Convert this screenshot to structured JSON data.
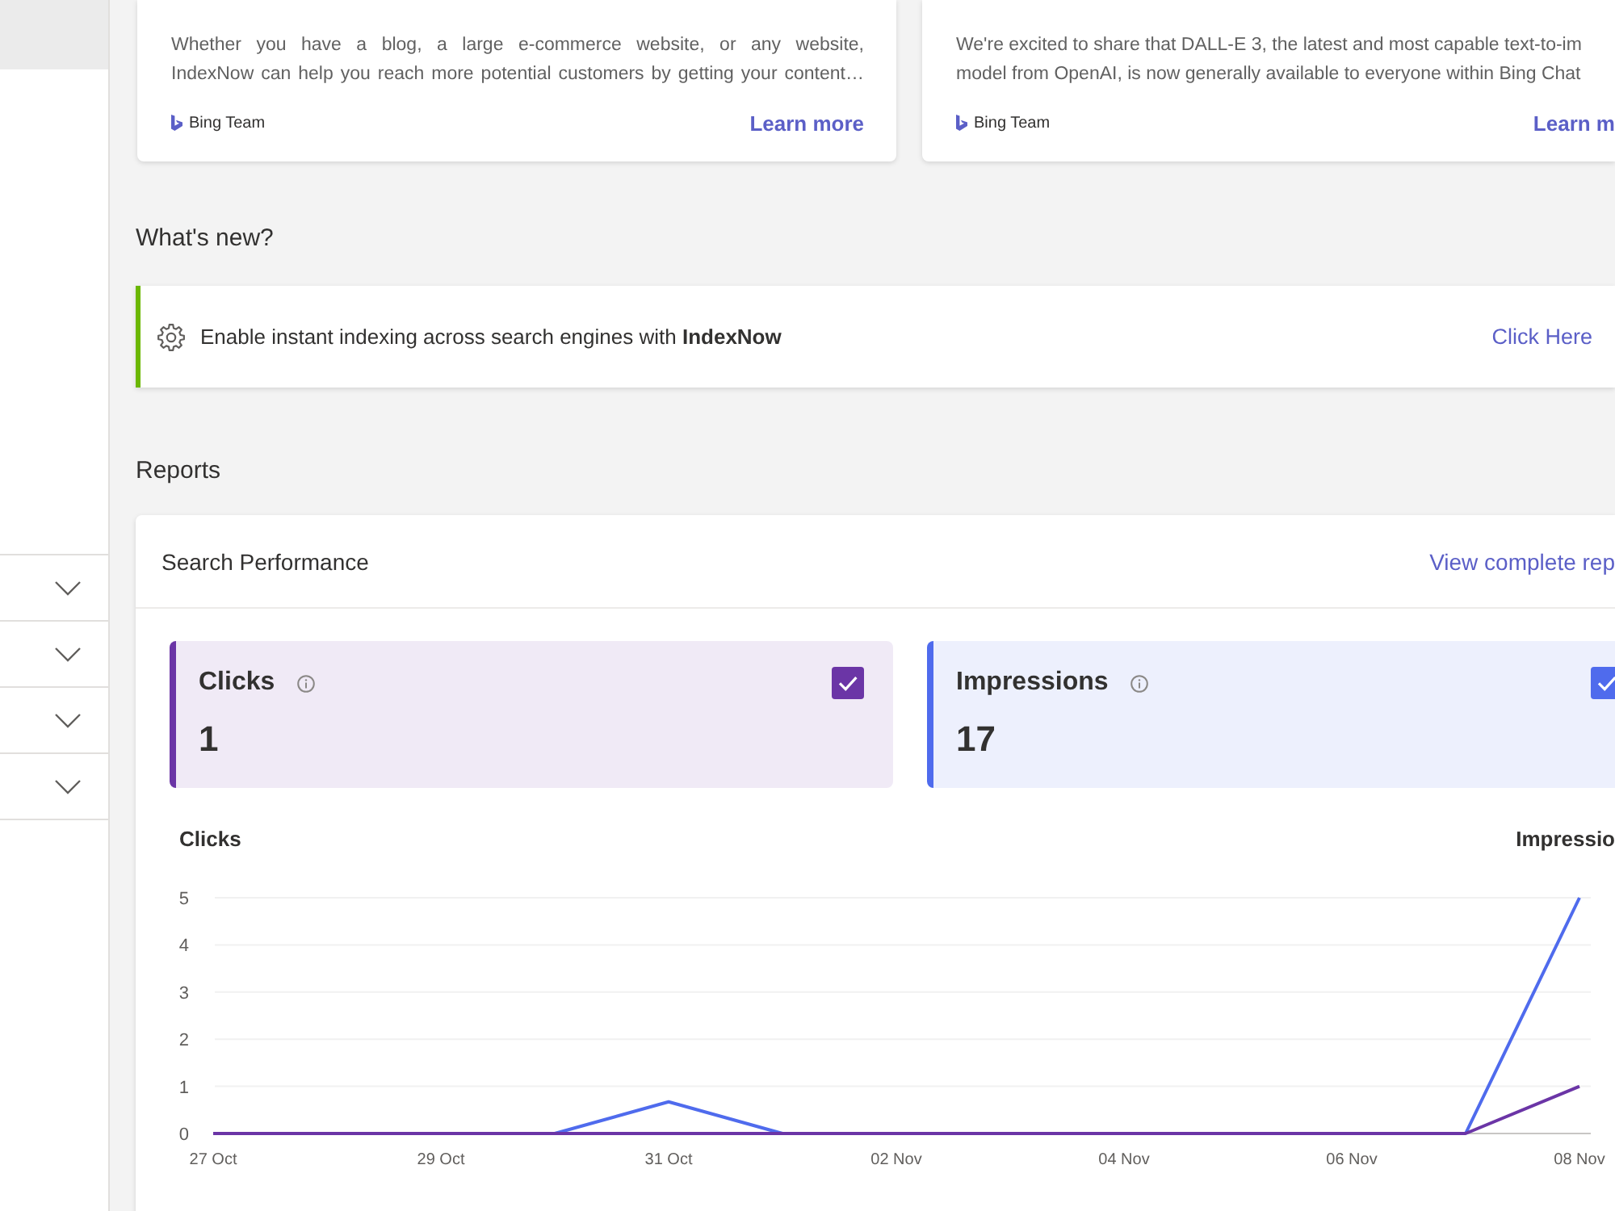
{
  "sidebar": {
    "nav_items": [
      {
        "selected": true
      }
    ],
    "sections": [
      {
        "expanded": false
      },
      {
        "expanded": false
      },
      {
        "expanded": false
      },
      {
        "expanded": false
      }
    ]
  },
  "news_cards": [
    {
      "body_lines": [
        "Whether you have a blog, a large e-commerce website, or any website,",
        "IndexNow can help you reach more potential customers by getting your content…"
      ],
      "author": "Bing Team",
      "link": "Learn more"
    },
    {
      "body_lines": [
        "We're excited to share that DALL-E 3, the latest and most capable text-to-im",
        "model from OpenAI, is now generally available to everyone within Bing Chat"
      ],
      "author": "Bing Team",
      "link": "Learn m"
    }
  ],
  "whats_new": {
    "heading": "What's new?",
    "banner": {
      "text": "Enable instant indexing across search engines with **IndexNow**",
      "link": "Click Here"
    }
  },
  "reports": {
    "heading": "Reports",
    "card": {
      "title": "Search Performance",
      "link": "View complete rep",
      "metrics": [
        {
          "label": "Clicks",
          "value": "1",
          "checked": true,
          "color": "#6b35a6"
        },
        {
          "label": "Impressions",
          "value": "17",
          "checked": true,
          "color": "#4f6bed"
        }
      ],
      "chart": {
        "left_axis_label": "Clicks",
        "right_axis_label": "Impressio",
        "chart_data": {
          "type": "line",
          "categories": [
            "27 Oct",
            null,
            "29 Oct",
            null,
            "31 Oct",
            null,
            "02 Nov",
            null,
            "04 Nov",
            null,
            "06 Nov",
            null,
            "08 Nov"
          ],
          "ylim": [
            0,
            5
          ],
          "yticks": [
            0,
            1,
            2,
            3,
            4,
            5
          ],
          "grid": true,
          "series": [
            {
              "color": "#4f6bed",
              "values": [
                null,
                null,
                null,
                0,
                0.67,
                0,
                null,
                null,
                null,
                null,
                null,
                0,
                5
              ]
            },
            {
              "color": "#6b35a6",
              "values": [
                0,
                0,
                0,
                0,
                0,
                0,
                0,
                0,
                0,
                0,
                0,
                0,
                1
              ]
            }
          ]
        }
      }
    }
  }
}
